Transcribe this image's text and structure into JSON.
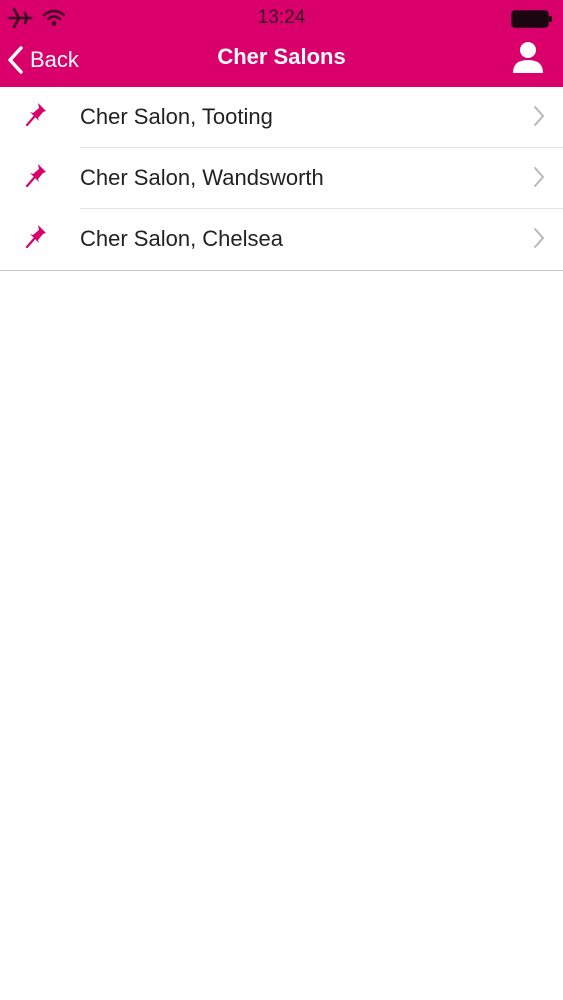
{
  "status_bar": {
    "time": "13:24",
    "icons": [
      "airplane-icon",
      "wifi-icon",
      "battery-icon"
    ]
  },
  "nav": {
    "back_label": "Back",
    "title": "Cher Salons",
    "right_icon": "profile-icon"
  },
  "salons": [
    {
      "name": "Cher Salon, Tooting"
    },
    {
      "name": "Cher Salon, Wandsworth"
    },
    {
      "name": "Cher Salon, Chelsea"
    }
  ],
  "colors": {
    "brand": "#d9006c",
    "text": "#222222",
    "chevron": "#b8b8b8"
  }
}
